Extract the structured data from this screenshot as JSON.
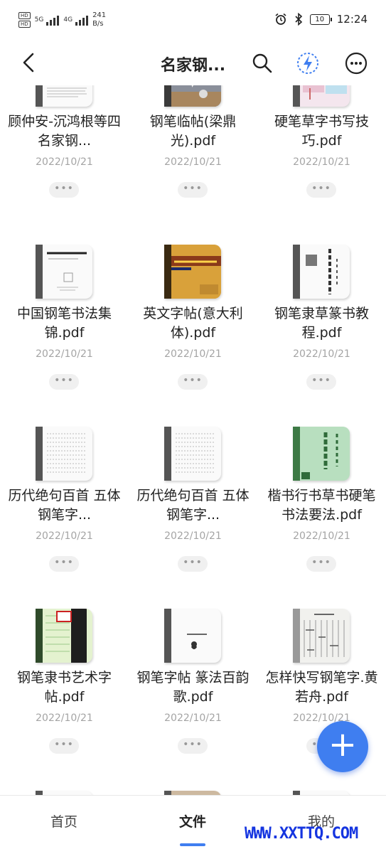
{
  "status_bar": {
    "sim_labels": [
      "HD",
      "HD"
    ],
    "network1": "5G",
    "network2": "4G",
    "speed_value": "241",
    "speed_unit": "B/s",
    "battery": "10",
    "time": "12:24",
    "icons": [
      "alarm-icon",
      "bluetooth-icon",
      "battery-icon"
    ]
  },
  "header": {
    "back_icon": "chevron-left-icon",
    "title": "名家钢...",
    "icons": [
      "search-icon",
      "lightning-icon",
      "more-icon"
    ],
    "accent_color": "#3f7ef0"
  },
  "files": [
    {
      "name": "顾仲安-沉鸿根等四名家钢...",
      "date": "2022/10/21"
    },
    {
      "name": "钢笔临帖(梁鼎光).pdf",
      "date": "2022/10/21"
    },
    {
      "name": "硬笔草字书写技巧.pdf",
      "date": "2022/10/21"
    },
    {
      "name": "中国钢笔书法集锦.pdf",
      "date": "2022/10/21"
    },
    {
      "name": "英文字帖(意大利体).pdf",
      "date": "2022/10/21"
    },
    {
      "name": "钢笔隶草篆书教程.pdf",
      "date": "2022/10/21"
    },
    {
      "name": "历代绝句百首 五体钢笔字...",
      "date": "2022/10/21"
    },
    {
      "name": "历代绝句百首 五体钢笔字...",
      "date": "2022/10/21"
    },
    {
      "name": "楷书行书草书硬笔书法要法.pdf",
      "date": "2022/10/21"
    },
    {
      "name": "钢笔隶书艺术字帖.pdf",
      "date": "2022/10/21"
    },
    {
      "name": "钢笔字帖 篆法百韵歌.pdf",
      "date": "2022/10/21"
    },
    {
      "name": "怎样快写钢笔字.黄若舟.pdf",
      "date": "2022/10/21"
    }
  ],
  "more_dots": "•••",
  "fab_label": "+",
  "bottom_nav": {
    "tabs": [
      "首页",
      "文件",
      "我的"
    ],
    "active": "文件"
  },
  "watermark": "WWW.XXTTQ.COM"
}
